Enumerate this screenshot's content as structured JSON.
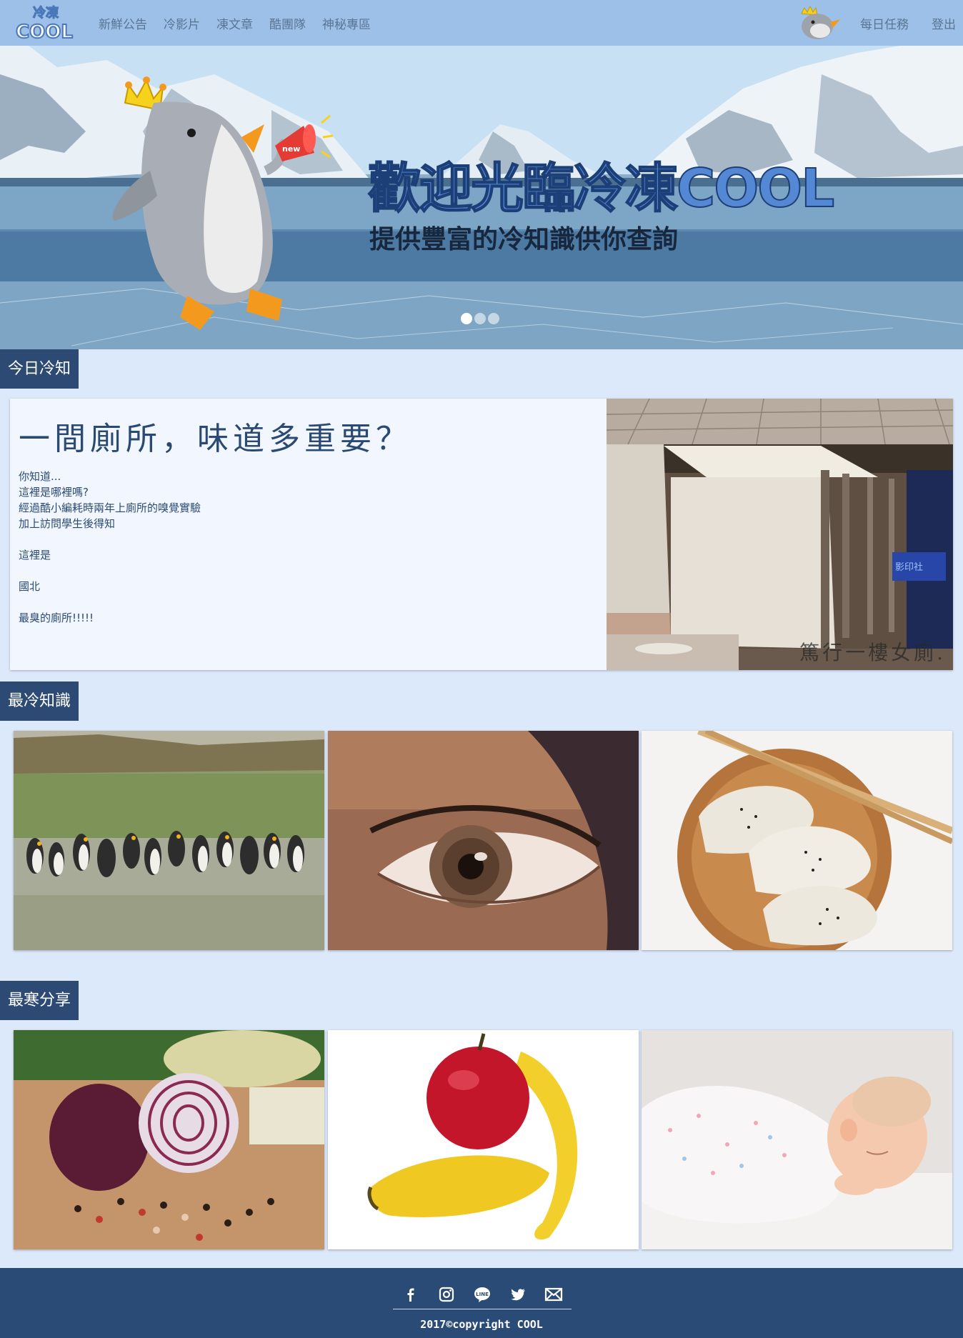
{
  "navbar": {
    "logo_text_top": "冷凍",
    "logo_text_bottom": "COOL",
    "links": [
      "新鮮公告",
      "冷影片",
      "凍文章",
      "酷團隊",
      "神秘專區"
    ],
    "right_links": [
      "每日任務",
      "登出"
    ]
  },
  "hero": {
    "title": "歡迎光臨冷凍COOL",
    "subtitle": "提供豐富的冷知識供你查詢",
    "megaphone_label": "new",
    "slides": 3,
    "active_slide": 0
  },
  "sections": {
    "today": "今日冷知",
    "coldest": "最冷知識",
    "share": "最寒分享"
  },
  "article": {
    "title": "一間廁所，味道多重要？",
    "lines": [
      "你知道...",
      "這裡是哪裡嗎?",
      "經過酷小編耗時兩年上廁所的嗅覺實驗",
      "加上訪問學生後得知",
      "",
      "這裡是",
      "",
      "國北",
      "",
      "最臭的廁所!!!!!"
    ],
    "image_caption": "篤行一樓女廁.",
    "sign_text": "影印社"
  },
  "coldest_tiles": [
    "penguins-photo",
    "eye-photo",
    "dumplings-photo"
  ],
  "share_tiles": [
    "onion-pepper-photo",
    "apple-banana-photo",
    "sleeping-baby-photo"
  ],
  "footer": {
    "icons": [
      "facebook-icon",
      "instagram-icon",
      "line-icon",
      "twitter-icon",
      "mail-icon"
    ],
    "line_label": "LINE",
    "copyright": "2017©copyright COOL"
  },
  "colors": {
    "navbar": "#9dc0e8",
    "page_bg": "#dce9fb",
    "section_label": "#2c4a74",
    "footer": "#2a4b76"
  }
}
